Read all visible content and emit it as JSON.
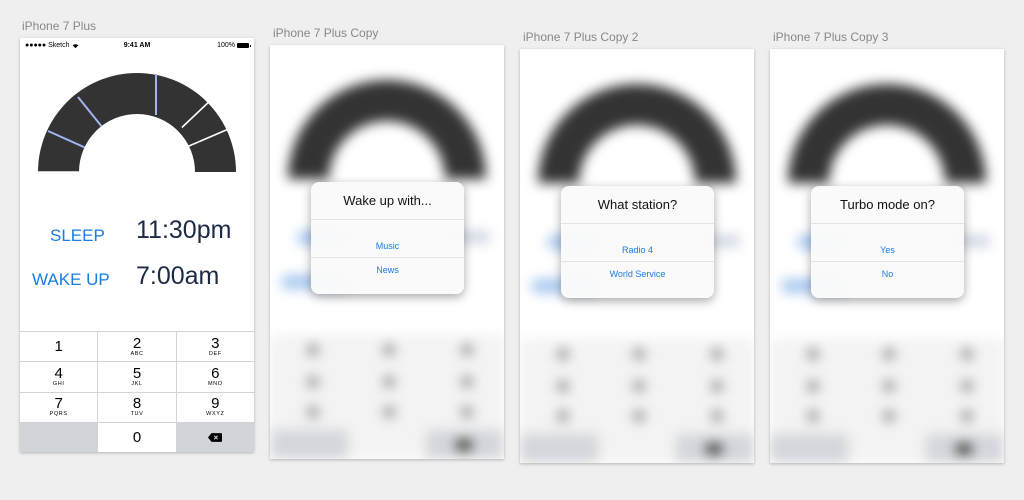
{
  "artboards": [
    {
      "label": "iPhone 7 Plus"
    },
    {
      "label": "iPhone 7 Plus Copy"
    },
    {
      "label": "iPhone 7 Plus Copy 2"
    },
    {
      "label": "iPhone 7 Plus Copy 3"
    }
  ],
  "status_bar": {
    "carrier": "●●●●● Sketch",
    "time": "9:41 AM",
    "battery": "100%"
  },
  "alarm": {
    "sleep_label": "SLEEP",
    "sleep_time": "11:30pm",
    "wake_label": "WAKE UP",
    "wake_time": "7:00am"
  },
  "keypad": [
    {
      "digit": "1",
      "letters": ""
    },
    {
      "digit": "2",
      "letters": "ABC"
    },
    {
      "digit": "3",
      "letters": "DEF"
    },
    {
      "digit": "4",
      "letters": "GHI"
    },
    {
      "digit": "5",
      "letters": "JKL"
    },
    {
      "digit": "6",
      "letters": "MNO"
    },
    {
      "digit": "7",
      "letters": "PQRS"
    },
    {
      "digit": "8",
      "letters": "TUV"
    },
    {
      "digit": "9",
      "letters": "WXYZ"
    },
    {
      "digit": "",
      "letters": ""
    },
    {
      "digit": "0",
      "letters": ""
    },
    {
      "digit": "",
      "letters": ""
    }
  ],
  "dialogs": [
    {
      "title": "Wake up with...",
      "options": [
        "Music",
        "News"
      ]
    },
    {
      "title": "What station?",
      "options": [
        "Radio 4",
        "World Service"
      ]
    },
    {
      "title": "Turbo mode on?",
      "options": [
        "Yes",
        "No"
      ]
    }
  ],
  "colors": {
    "accent": "#1a7ce0",
    "gauge": "#333333",
    "gauge_marker": "#9fb4f0",
    "time_text": "#1c2a44"
  }
}
